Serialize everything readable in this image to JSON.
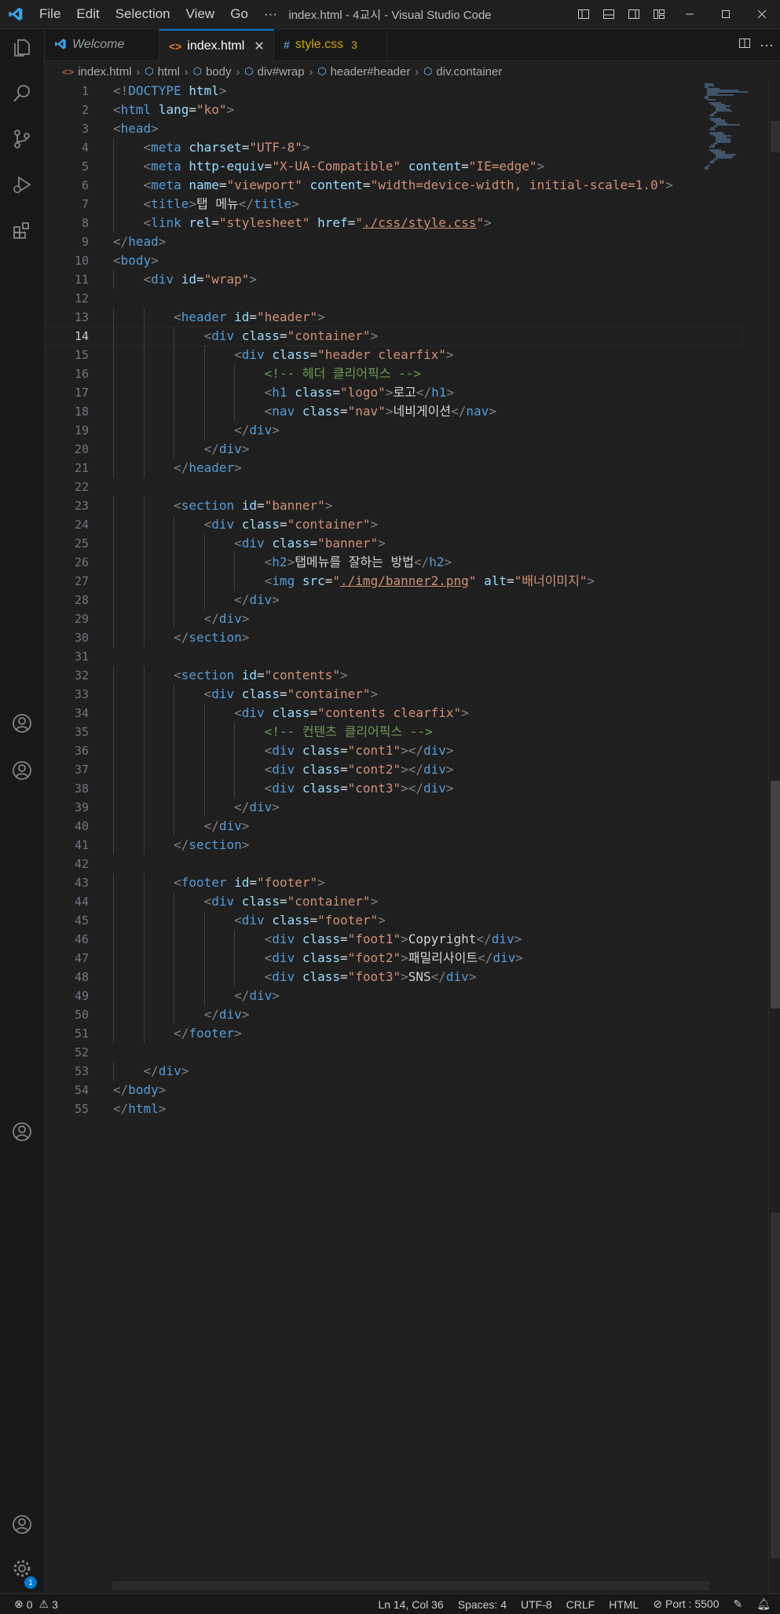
{
  "titlebar": {
    "menu": [
      "File",
      "Edit",
      "Selection",
      "View",
      "Go",
      "···"
    ],
    "window_title": "index.html - 4교시 - Visual Studio Code"
  },
  "tabs": [
    {
      "label": "Welcome",
      "icon": "vscode-icon",
      "active": false
    },
    {
      "label": "index.html",
      "icon": "html-icon",
      "active": true
    },
    {
      "label": "style.css",
      "icon": "css-icon",
      "active": false,
      "count": "3"
    }
  ],
  "breadcrumb": [
    "index.html",
    "html",
    "body",
    "div#wrap",
    "header#header",
    "div.container"
  ],
  "editor": {
    "active_line": 14,
    "lines": [
      "<!DOCTYPE html>",
      "<html lang=\"ko\">",
      "<head>",
      "    <meta charset=\"UTF-8\">",
      "    <meta http-equiv=\"X-UA-Compatible\" content=\"IE=edge\">",
      "    <meta name=\"viewport\" content=\"width=device-width, initial-scale=1.0\">",
      "    <title>탭 메뉴</title>",
      "    <link rel=\"stylesheet\" href=\"./css/style.css\">",
      "</head>",
      "<body>",
      "    <div id=\"wrap\">",
      "",
      "        <header id=\"header\">",
      "            <div class=\"container\">",
      "                <div class=\"header clearfix\">",
      "                    <!-- 헤더 클리어픽스 -->",
      "                    <h1 class=\"logo\">로고</h1>",
      "                    <nav class=\"nav\">네비게이션</nav>",
      "                </div>",
      "            </div>",
      "        </header>",
      "",
      "        <section id=\"banner\">",
      "            <div class=\"container\">",
      "                <div class=\"banner\">",
      "                    <h2>탭메뉴를 잘하는 방법</h2>",
      "                    <img src=\"./img/banner2.png\" alt=\"배너이미지\">",
      "                </div>",
      "            </div>",
      "        </section>",
      "",
      "        <section id=\"contents\">",
      "            <div class=\"container\">",
      "                <div class=\"contents clearfix\">",
      "                    <!-- 컨텐츠 클리어픽스 -->",
      "                    <div class=\"cont1\"></div>",
      "                    <div class=\"cont2\"></div>",
      "                    <div class=\"cont3\"></div>",
      "                </div>",
      "            </div>",
      "        </section>",
      "",
      "        <footer id=\"footer\">",
      "            <div class=\"container\">",
      "                <div class=\"footer\">",
      "                    <div class=\"foot1\">Copyright</div>",
      "                    <div class=\"foot2\">패밀리사이트</div>",
      "                    <div class=\"foot3\">SNS</div>",
      "                </div>",
      "            </div>",
      "        </footer>",
      "",
      "    </div>",
      "</body>",
      "</html>"
    ]
  },
  "statusbar": {
    "errors": "0",
    "warnings": "3",
    "cursor": "Ln 14, Col 36",
    "spaces": "Spaces: 4",
    "encoding": "UTF-8",
    "eol": "CRLF",
    "language": "HTML",
    "port": "Port : 5500"
  },
  "activity": {
    "settings_badge": "1"
  },
  "colors": {
    "accent": "#0078d4",
    "tag": "#569cd6",
    "attr": "#9cdcfe",
    "string": "#ce9178",
    "comment": "#6a9955",
    "warning": "#cca700"
  }
}
